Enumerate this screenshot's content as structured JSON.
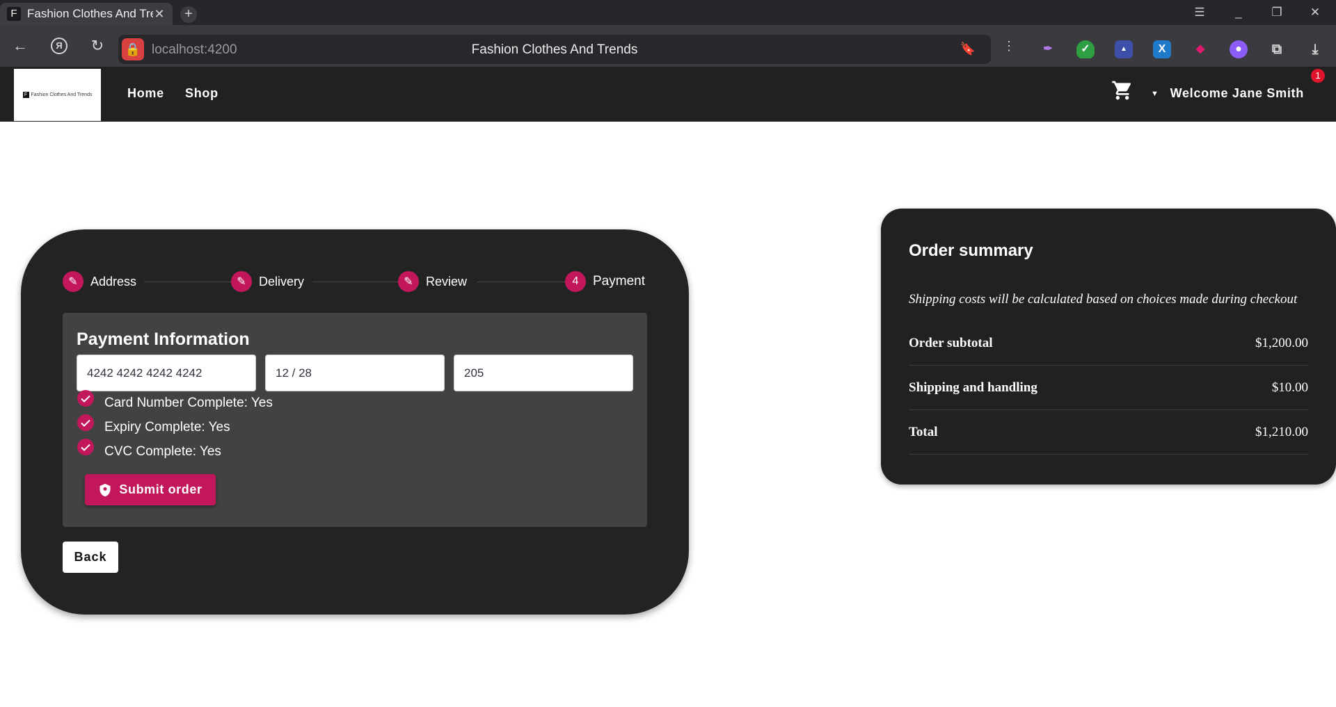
{
  "browser": {
    "tab_title": "Fashion Clothes And Trends",
    "tab_favicon": "F",
    "url": "localhost:4200",
    "page_title": "Fashion Clothes And Trends"
  },
  "header": {
    "logo_text": "Fashion Clothes And Trends",
    "nav": {
      "home": "Home",
      "shop": "Shop"
    },
    "cart_count": "1",
    "welcome": "Welcome Jane Smith"
  },
  "stepper": {
    "steps": [
      {
        "label": "Address",
        "icon": "pencil-icon"
      },
      {
        "label": "Delivery",
        "icon": "pencil-icon"
      },
      {
        "label": "Review",
        "icon": "pencil-icon"
      },
      {
        "label": "Payment",
        "number": "4"
      }
    ]
  },
  "payment": {
    "title": "Payment Information",
    "card_number": "4242 4242 4242 4242",
    "expiry": "12 / 28",
    "cvc": "205",
    "status": {
      "card": "Card Number Complete: Yes",
      "expiry": "Expiry Complete: Yes",
      "cvc": "CVC Complete: Yes"
    },
    "submit_label": "Submit order",
    "back_label": "Back"
  },
  "summary": {
    "title": "Order summary",
    "note": "Shipping costs will be calculated based on choices made during checkout",
    "rows": [
      {
        "label": "Order subtotal",
        "value": "$1,200.00"
      },
      {
        "label": "Shipping and handling",
        "value": "$10.00"
      },
      {
        "label": "Total",
        "value": "$1,210.00"
      }
    ]
  },
  "colors": {
    "accent": "#c2185b",
    "header_bg": "#212121",
    "card_bg": "#232323",
    "panel_bg": "#424242"
  }
}
